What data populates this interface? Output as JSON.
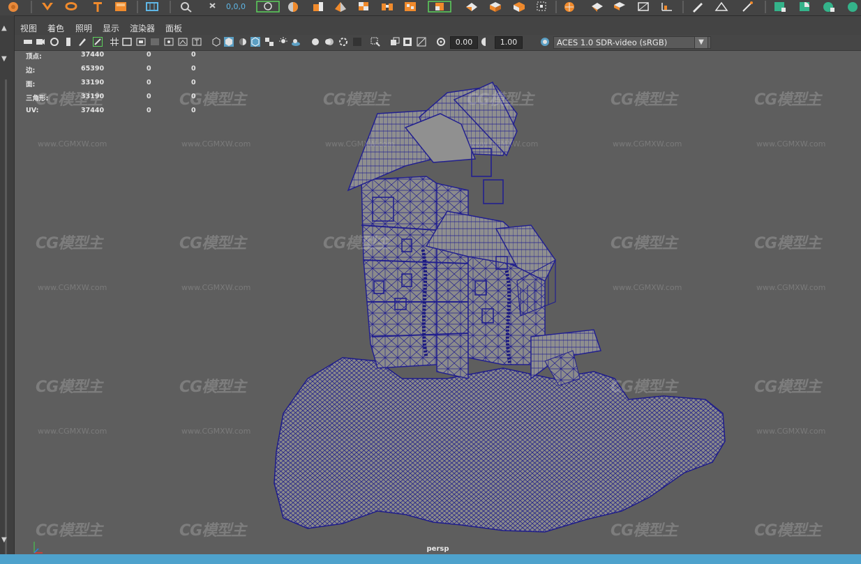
{
  "shelf": {
    "coordinates_text": "0,0,0",
    "accent": "#f08a2c",
    "icons": [
      "sphere-tool-icon",
      "bend-icon",
      "loop-icon",
      "text-tool-icon",
      "box-icon",
      "grid-snap-icon",
      "view-search-icon",
      "move-xyz-icon",
      "select-region-icon",
      "sphere-object-icon",
      "extrude-icon",
      "bevel-icon",
      "checker-icon",
      "bridge-icon",
      "pattern-icon",
      "split-icon",
      "combine-icon",
      "cube-unfold-icon",
      "layout-icon",
      "pin-icon",
      "sculpt-icon",
      "target-icon",
      "paint-icon",
      "bend-deform-icon",
      "chart-icon",
      "pen-icon",
      "pattern-uv-icon",
      "triangle-edit-icon",
      "green-cube-icon",
      "green-half-icon",
      "green-split-icon",
      "green-sphere-icon"
    ]
  },
  "menu": {
    "items": [
      "视图",
      "着色",
      "照明",
      "显示",
      "渲染器",
      "面板"
    ]
  },
  "toolbar": {
    "exposure_value": "0.00",
    "gamma_value": "1.00",
    "color_space": "ACES 1.0 SDR-video (sRGB)"
  },
  "hud": {
    "rows": [
      {
        "label": "顶点:",
        "c1": "37440",
        "c2": "0",
        "c3": "0"
      },
      {
        "label": "边:",
        "c1": "65390",
        "c2": "0",
        "c3": "0"
      },
      {
        "label": "面:",
        "c1": "33190",
        "c2": "0",
        "c3": "0"
      },
      {
        "label": "三角形:",
        "c1": "33190",
        "c2": "0",
        "c3": "0"
      },
      {
        "label": "UV:",
        "c1": "37440",
        "c2": "0",
        "c3": "0"
      }
    ]
  },
  "watermark": {
    "logo_text": "CG模型主",
    "url_text": "www.CGMXW.com"
  },
  "viewport": {
    "camera_name": "persp",
    "wire_color": "#1f1d8c",
    "mesh_color": "#8a8a8a",
    "bg_color": "#5e5e5e"
  }
}
